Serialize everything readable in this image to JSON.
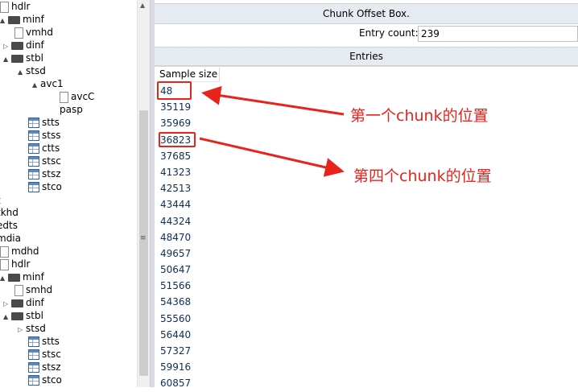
{
  "tree": {
    "items": [
      {
        "label": "hdlr",
        "icon": "file",
        "toggle": ""
      },
      {
        "label": "minf",
        "icon": "folder",
        "toggle": "▲"
      },
      {
        "label": "vmhd",
        "icon": "file",
        "toggle": ""
      },
      {
        "label": "dinf",
        "icon": "folder",
        "toggle": "▷"
      },
      {
        "label": "stbl",
        "icon": "folder",
        "toggle": "▲"
      },
      {
        "label": "stsd",
        "icon": "none",
        "toggle": "▲"
      },
      {
        "label": "avc1",
        "icon": "none",
        "toggle": "▲"
      },
      {
        "label": "avcC",
        "icon": "file",
        "toggle": ""
      },
      {
        "label": "pasp",
        "icon": "none",
        "toggle": ""
      },
      {
        "label": "stts",
        "icon": "table",
        "toggle": ""
      },
      {
        "label": "stss",
        "icon": "table",
        "toggle": ""
      },
      {
        "label": "ctts",
        "icon": "table",
        "toggle": ""
      },
      {
        "label": "stsc",
        "icon": "table",
        "toggle": ""
      },
      {
        "label": "stsz",
        "icon": "table",
        "toggle": ""
      },
      {
        "label": "stco",
        "icon": "table",
        "toggle": ""
      },
      {
        "label": "t",
        "icon": "none",
        "toggle": ""
      },
      {
        "label": "tkhd",
        "icon": "none",
        "toggle": ""
      },
      {
        "label": "edts",
        "icon": "none",
        "toggle": ""
      },
      {
        "label": "mdia",
        "icon": "none",
        "toggle": ""
      },
      {
        "label": "mdhd",
        "icon": "file",
        "toggle": ""
      },
      {
        "label": "hdlr",
        "icon": "file",
        "toggle": ""
      },
      {
        "label": "minf",
        "icon": "folder",
        "toggle": "▲"
      },
      {
        "label": "smhd",
        "icon": "file",
        "toggle": ""
      },
      {
        "label": "dinf",
        "icon": "folder",
        "toggle": "▷"
      },
      {
        "label": "stbl",
        "icon": "folder",
        "toggle": "▲"
      },
      {
        "label": "stsd",
        "icon": "none",
        "toggle": "▷"
      },
      {
        "label": "stts",
        "icon": "table",
        "toggle": ""
      },
      {
        "label": "stsc",
        "icon": "table",
        "toggle": ""
      },
      {
        "label": "stsz",
        "icon": "table",
        "toggle": ""
      },
      {
        "label": "stco",
        "icon": "table",
        "toggle": ""
      }
    ]
  },
  "panel": {
    "title": "Chunk Offset Box.",
    "entry_count_label": "Entry count:",
    "entry_count_value": "239",
    "entries_header": "Entries",
    "column_header": "Sample size",
    "rows": [
      "48",
      "35119",
      "35969",
      "36823",
      "37685",
      "41323",
      "42513",
      "43444",
      "44324",
      "48470",
      "49657",
      "50647",
      "51566",
      "54368",
      "55560",
      "56440",
      "57327",
      "59916",
      "60857"
    ]
  },
  "annotations": {
    "first": "第一个chunk的位置",
    "fourth": "第四个chunk的位置",
    "color": "#e8231b"
  }
}
